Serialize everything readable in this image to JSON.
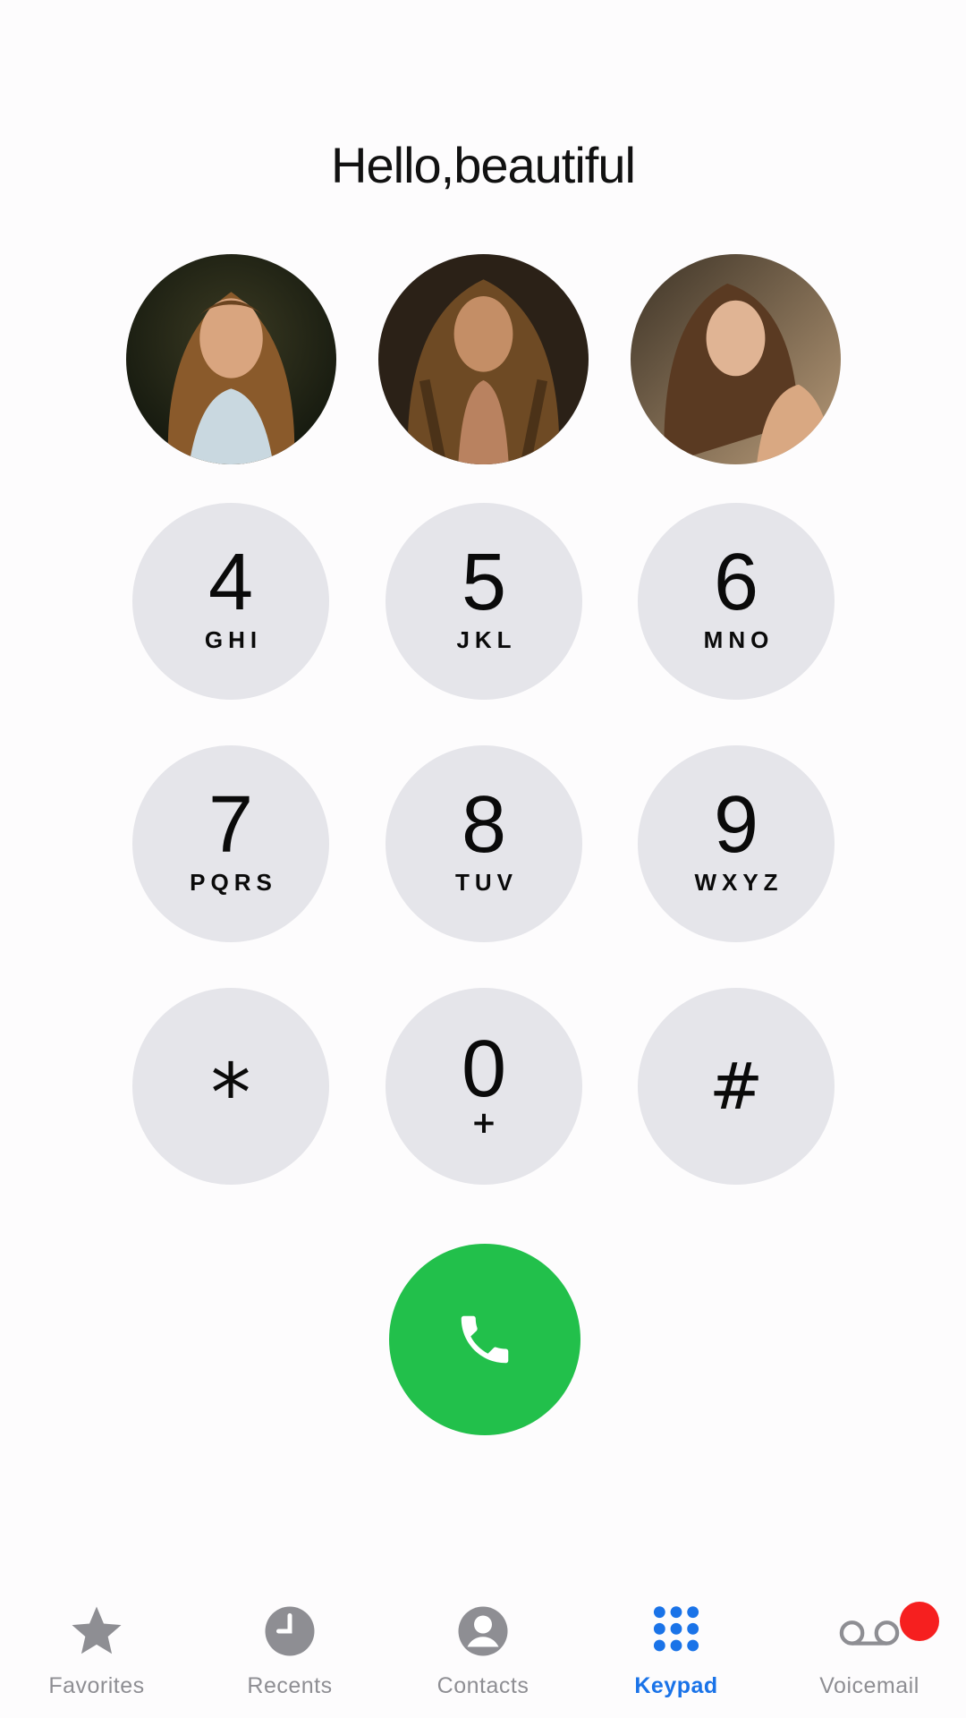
{
  "greeting": "Hello,beautiful",
  "favorites_avatars": [
    {
      "icon": "avatar-photo-1"
    },
    {
      "icon": "avatar-photo-2"
    },
    {
      "icon": "avatar-photo-3"
    }
  ],
  "keypad": {
    "keys": [
      {
        "digit": "4",
        "letters": "GHI"
      },
      {
        "digit": "5",
        "letters": "JKL"
      },
      {
        "digit": "6",
        "letters": "MNO"
      },
      {
        "digit": "7",
        "letters": "PQRS"
      },
      {
        "digit": "8",
        "letters": "TUV"
      },
      {
        "digit": "9",
        "letters": "WXYZ"
      },
      {
        "digit": "*",
        "letters": ""
      },
      {
        "digit": "0",
        "letters": "+"
      },
      {
        "digit": "#",
        "letters": ""
      }
    ],
    "call_icon": "phone-icon",
    "call_color": "#22c04b",
    "key_color": "#e5e5ea"
  },
  "tabbar": {
    "tabs": [
      {
        "label": "Favorites",
        "icon": "star-icon",
        "active": false
      },
      {
        "label": "Recents",
        "icon": "clock-icon",
        "active": false
      },
      {
        "label": "Contacts",
        "icon": "person-icon",
        "active": false
      },
      {
        "label": "Keypad",
        "icon": "keypad-grid-icon",
        "active": true
      },
      {
        "label": "Voicemail",
        "icon": "voicemail-icon",
        "active": false,
        "badge": true
      }
    ],
    "active_color": "#1a73e8",
    "inactive_color": "#8e8e93",
    "badge_color": "#f61f1f"
  }
}
